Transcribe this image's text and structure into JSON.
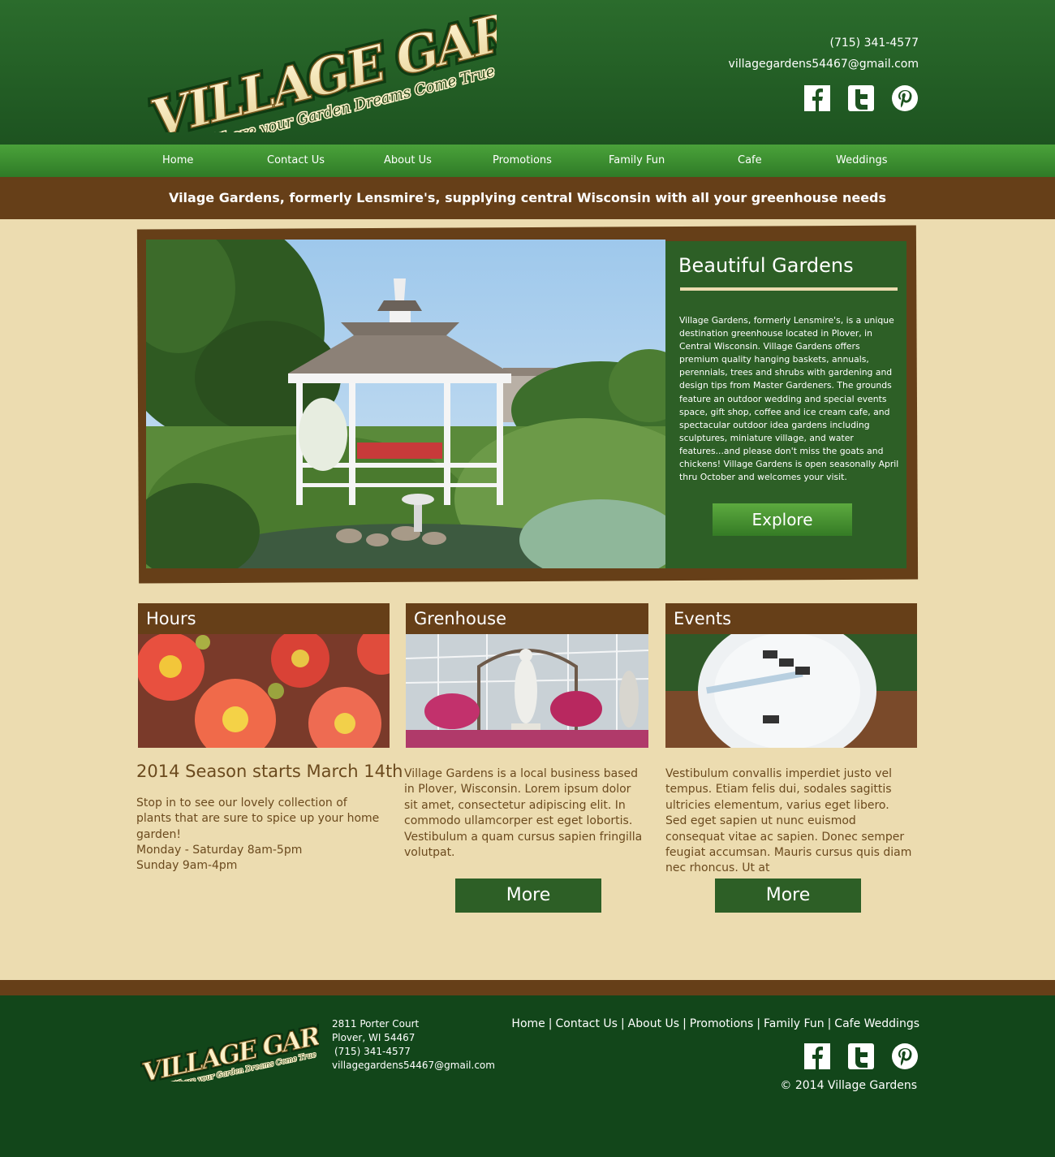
{
  "brand": {
    "name_line1": "VILLAGE GARDENS",
    "slogan": "Where your Garden Dreams Come True"
  },
  "header": {
    "phone": "(715) 341-4577",
    "email": "villagegardens54467@gmail.com",
    "social": [
      "facebook-icon",
      "twitter-icon",
      "pinterest-icon"
    ]
  },
  "nav": {
    "items": [
      {
        "label": "Home"
      },
      {
        "label": "Contact Us"
      },
      {
        "label": "About Us"
      },
      {
        "label": "Promotions"
      },
      {
        "label": "Family Fun"
      },
      {
        "label": "Cafe"
      },
      {
        "label": "Weddings"
      }
    ]
  },
  "tagline": "Vilage Gardens, formerly Lensmire's, supplying central Wisconsin with all your greenhouse needs",
  "hero": {
    "title": "Beautiful Gardens",
    "text": "Village Gardens, formerly Lensmire's, is a unique destination greenhouse located in Plover, in Central Wisconsin.  Village Gardens offers premium quality hanging baskets, annuals, perennials, trees and shrubs with gardening and design tips from Master Gardeners.  The grounds feature an outdoor wedding and special events space, gift shop, coffee and ice cream cafe, and spectacular outdoor idea gardens including sculptures, miniature village, and water features...and please don't miss the goats and chickens!  Village Gardens is open seasonally April thru October and welcomes your visit.",
    "button": "Explore"
  },
  "columns": {
    "hours": {
      "heading": "Hours",
      "subheading": "2014 Season starts March 14th",
      "text": "Stop in to see our lovely collection of plants that are sure to spice up your home garden!",
      "weekday": "Monday - Saturday 8am-5pm",
      "sunday": "Sunday 9am-4pm"
    },
    "greenhouse": {
      "heading": "Grenhouse",
      "text": "Village Gardens is a local business based in Plover, Wisconsin.  Lorem ipsum dolor sit amet, consectetur adipiscing elit. In commodo ullamcorper est eget lobortis. Vestibulum a quam cursus sapien fringilla volutpat.",
      "button": "More"
    },
    "events": {
      "heading": "Events",
      "text": "Vestibulum convallis imperdiet justo vel tempus. Etiam felis dui, sodales sagittis ultricies elementum, varius eget libero. Sed eget sapien ut nunc euismod consequat vitae ac sapien. Donec semper feugiat accumsan. Mauris cursus quis diam nec rhoncus. Ut at",
      "button": "More"
    }
  },
  "footer": {
    "address1": "2811 Porter Court",
    "address2": "Plover, WI 54467",
    "phone": "(715) 341-4577",
    "email": "villagegardens54467@gmail.com",
    "links": [
      "Home",
      "Contact Us",
      "About Us",
      "Promotions",
      "Family Fun",
      "Cafe Weddings"
    ],
    "separator": "|",
    "copyright": "© 2014 Village Gardens"
  },
  "colors": {
    "header_green": "#2b6c2c",
    "nav_green": "#4aa23a",
    "brown": "#663f18",
    "cream": "#ecdcb0",
    "panel_green": "#2d5f26",
    "footer_green": "#12461a"
  }
}
